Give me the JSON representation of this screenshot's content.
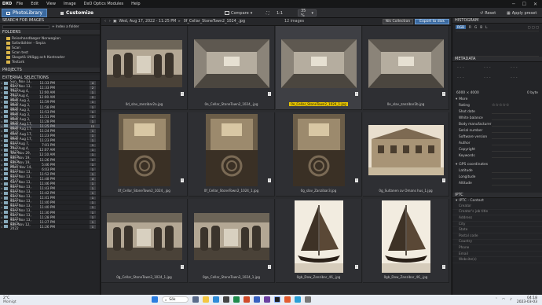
{
  "menubar": {
    "logo": "DXO",
    "items": [
      "File",
      "Edit",
      "View",
      "Image",
      "DxO Optics Modules",
      "Help"
    ]
  },
  "toolbar": {
    "tab_library": "PhotoLibrary",
    "tab_customize": "Customize",
    "compare_label": "Compare",
    "zoom_ratio": "1:1",
    "zoom_percent": "35 %",
    "reset_label": "Reset",
    "apply_preset_label": "Apply preset"
  },
  "left": {
    "search_title": "SEARCH FOR IMAGES",
    "index_folder": "+ Index a folder",
    "folders_title": "FOLDERS",
    "folders": [
      "Reisehandbøger Norwegian",
      "Safaribilder - Sepia",
      "Scan",
      "Scan test",
      "Skogstä Utlägg och Kostnader",
      "Testark"
    ],
    "projects_title": "PROJECTS",
    "ext_title": "EXTERNAL SELECTIONS",
    "projects": [
      {
        "d": "Sun, Nov 13, 2022",
        "t": "11:33 PM",
        "c": "4"
      },
      {
        "d": "Sun, Nov 13, 2022",
        "t": "11:33 PM",
        "c": "2"
      },
      {
        "d": "Thu, Aug 4, 2022",
        "t": "12:00 AM",
        "c": "1"
      },
      {
        "d": "Thu, Aug 4, 2022",
        "t": "12:00 AM",
        "c": "2"
      },
      {
        "d": "Wed, Aug 3, 2022",
        "t": "11:59 PM",
        "c": "1"
      },
      {
        "d": "Wed, Aug 3, 2022",
        "t": "11:58 PM",
        "c": "1"
      },
      {
        "d": "Wed, Aug 3, 2022",
        "t": "11:53 PM",
        "c": "1"
      },
      {
        "d": "Wed, Aug 3, 2022",
        "t": "11:51 PM",
        "c": "1"
      },
      {
        "d": "Wed, Aug 3, 2022",
        "t": "11:28 PM",
        "c": "1"
      },
      {
        "d": "Wed, Aug 17, 2022",
        "t": "11:25 PM",
        "c": "12"
      },
      {
        "d": "Wed, Aug 17, 2022",
        "t": "11:24 PM",
        "c": "1"
      },
      {
        "d": "Wed, Aug 17, 2022",
        "t": "11:23 PM",
        "c": "1"
      },
      {
        "d": "Wed, Aug 17, 2022",
        "t": "11:23 PM",
        "c": "1"
      },
      {
        "d": "Sun, Aug 7, 2022",
        "t": "7:01 PM",
        "c": "1"
      },
      {
        "d": "Thu, Aug 4, 2022",
        "t": "12:07 AM",
        "c": "1"
      },
      {
        "d": "Tue, Nov 29, 2022",
        "t": "12:10 AM",
        "c": "1"
      },
      {
        "d": "Sat, Nov 19, 2022",
        "t": "11:26 PM",
        "c": "1"
      },
      {
        "d": "Sat, Nov 19, 2022",
        "t": "5:46 PM",
        "c": "1"
      },
      {
        "d": "Mon, Nov 14, 2022",
        "t": "6:03 PM",
        "c": "1"
      },
      {
        "d": "Sun, Nov 13, 2022",
        "t": "11:52 PM",
        "c": "1"
      },
      {
        "d": "Sun, Nov 13, 2022",
        "t": "11:48 PM",
        "c": "4"
      },
      {
        "d": "Sun, Nov 13, 2022",
        "t": "11:46 PM",
        "c": "1"
      },
      {
        "d": "Sun, Nov 13, 2022",
        "t": "11:43 PM",
        "c": "1"
      },
      {
        "d": "Sun, Nov 13, 2022",
        "t": "11:42 PM",
        "c": "1"
      },
      {
        "d": "Sun, Nov 13, 2022",
        "t": "11:41 PM",
        "c": "1"
      },
      {
        "d": "Sun, Nov 13, 2022",
        "t": "11:40 PM",
        "c": "1"
      },
      {
        "d": "Sun, Nov 13, 2022",
        "t": "11:40 PM",
        "c": "1"
      },
      {
        "d": "Sun, Nov 13, 2022",
        "t": "11:30 PM",
        "c": "1"
      },
      {
        "d": "Sun, Nov 13, 2022",
        "t": "11:28 PM",
        "c": "1"
      },
      {
        "d": "Sun, Nov 13, 2022",
        "t": "11:27 PM",
        "c": "1"
      },
      {
        "d": "Sat, Nov 12, 2022",
        "t": "11:26 PM",
        "c": "1"
      }
    ]
  },
  "center": {
    "current_selection": "Wed, Aug 17, 2022 - 11:25 PM",
    "current_file": "0f_Cellar_StoneTown2_1024_.jpg",
    "count_label": "12 images",
    "nik_label": "Nik Collection",
    "export_label": "Export to disk",
    "images": [
      {
        "cap": "0d_slav_zanzibar2a.jpg",
        "kind": "statues"
      },
      {
        "cap": "0e_Cellar_StoneTown2_1024_.jpg",
        "kind": "room"
      },
      {
        "cap": "0e_Cellar_StoneTown2_1024_1.jpg",
        "kind": "room",
        "hl": true
      },
      {
        "cap": "0e_slav_zanzibar2b.jpg",
        "kind": "room"
      },
      {
        "cap": "0f_Cellar_StoneTown2_1024_.jpg",
        "kind": "cellar"
      },
      {
        "cap": "0f_Cellar_StoneTown2_1024_1.jpg",
        "kind": "cellar"
      },
      {
        "cap": "0g_slav_Zanzibar3.jpg",
        "kind": "cellar"
      },
      {
        "cap": "0g_Sultanen av Omans hus_1.jpg",
        "kind": "house"
      },
      {
        "cap": "0g_Cellar_StoneTown3_1024_1.jpg",
        "kind": "statues"
      },
      {
        "cap": "0ga_Cellar_StoneTown3_1024_1.jpg",
        "kind": "statues"
      },
      {
        "cap": "0gb_Dow_Zanzibar_46_.jpg",
        "kind": "dhow"
      },
      {
        "cap": "0gb_Dow_Zanzibar_46_.jpg",
        "kind": "dhow"
      }
    ]
  },
  "right": {
    "histogram_title": "HISTOGRAM",
    "channels": [
      "RGB",
      "R",
      "G",
      "B",
      "L"
    ],
    "metadata_title": "METADATA",
    "size_label": "6000 × 4000",
    "file_size": "0 byte",
    "more_label": "More",
    "fields": [
      "Rating",
      "Shot date",
      "White balance",
      "Body manufacturer",
      "Serial number",
      "Software version",
      "Author",
      "Copyright",
      "Keywords"
    ],
    "gps_title": "GPS coordinates",
    "gps_fields": [
      "Latitude",
      "Longitude",
      "Altitude"
    ],
    "iptc_title": "IPTC",
    "iptc_contact": "IPTC - Contact",
    "iptc_fields": [
      "Creator",
      "Creator's job title",
      "Address",
      "City",
      "State",
      "Postal code",
      "Country",
      "Phone",
      "Email",
      "Website(s)"
    ]
  },
  "taskbar": {
    "weather_temp": "2°C",
    "weather_desc": "Molnigt",
    "search_label": "Sök",
    "time": "04:18",
    "date": "2023-03-03"
  }
}
